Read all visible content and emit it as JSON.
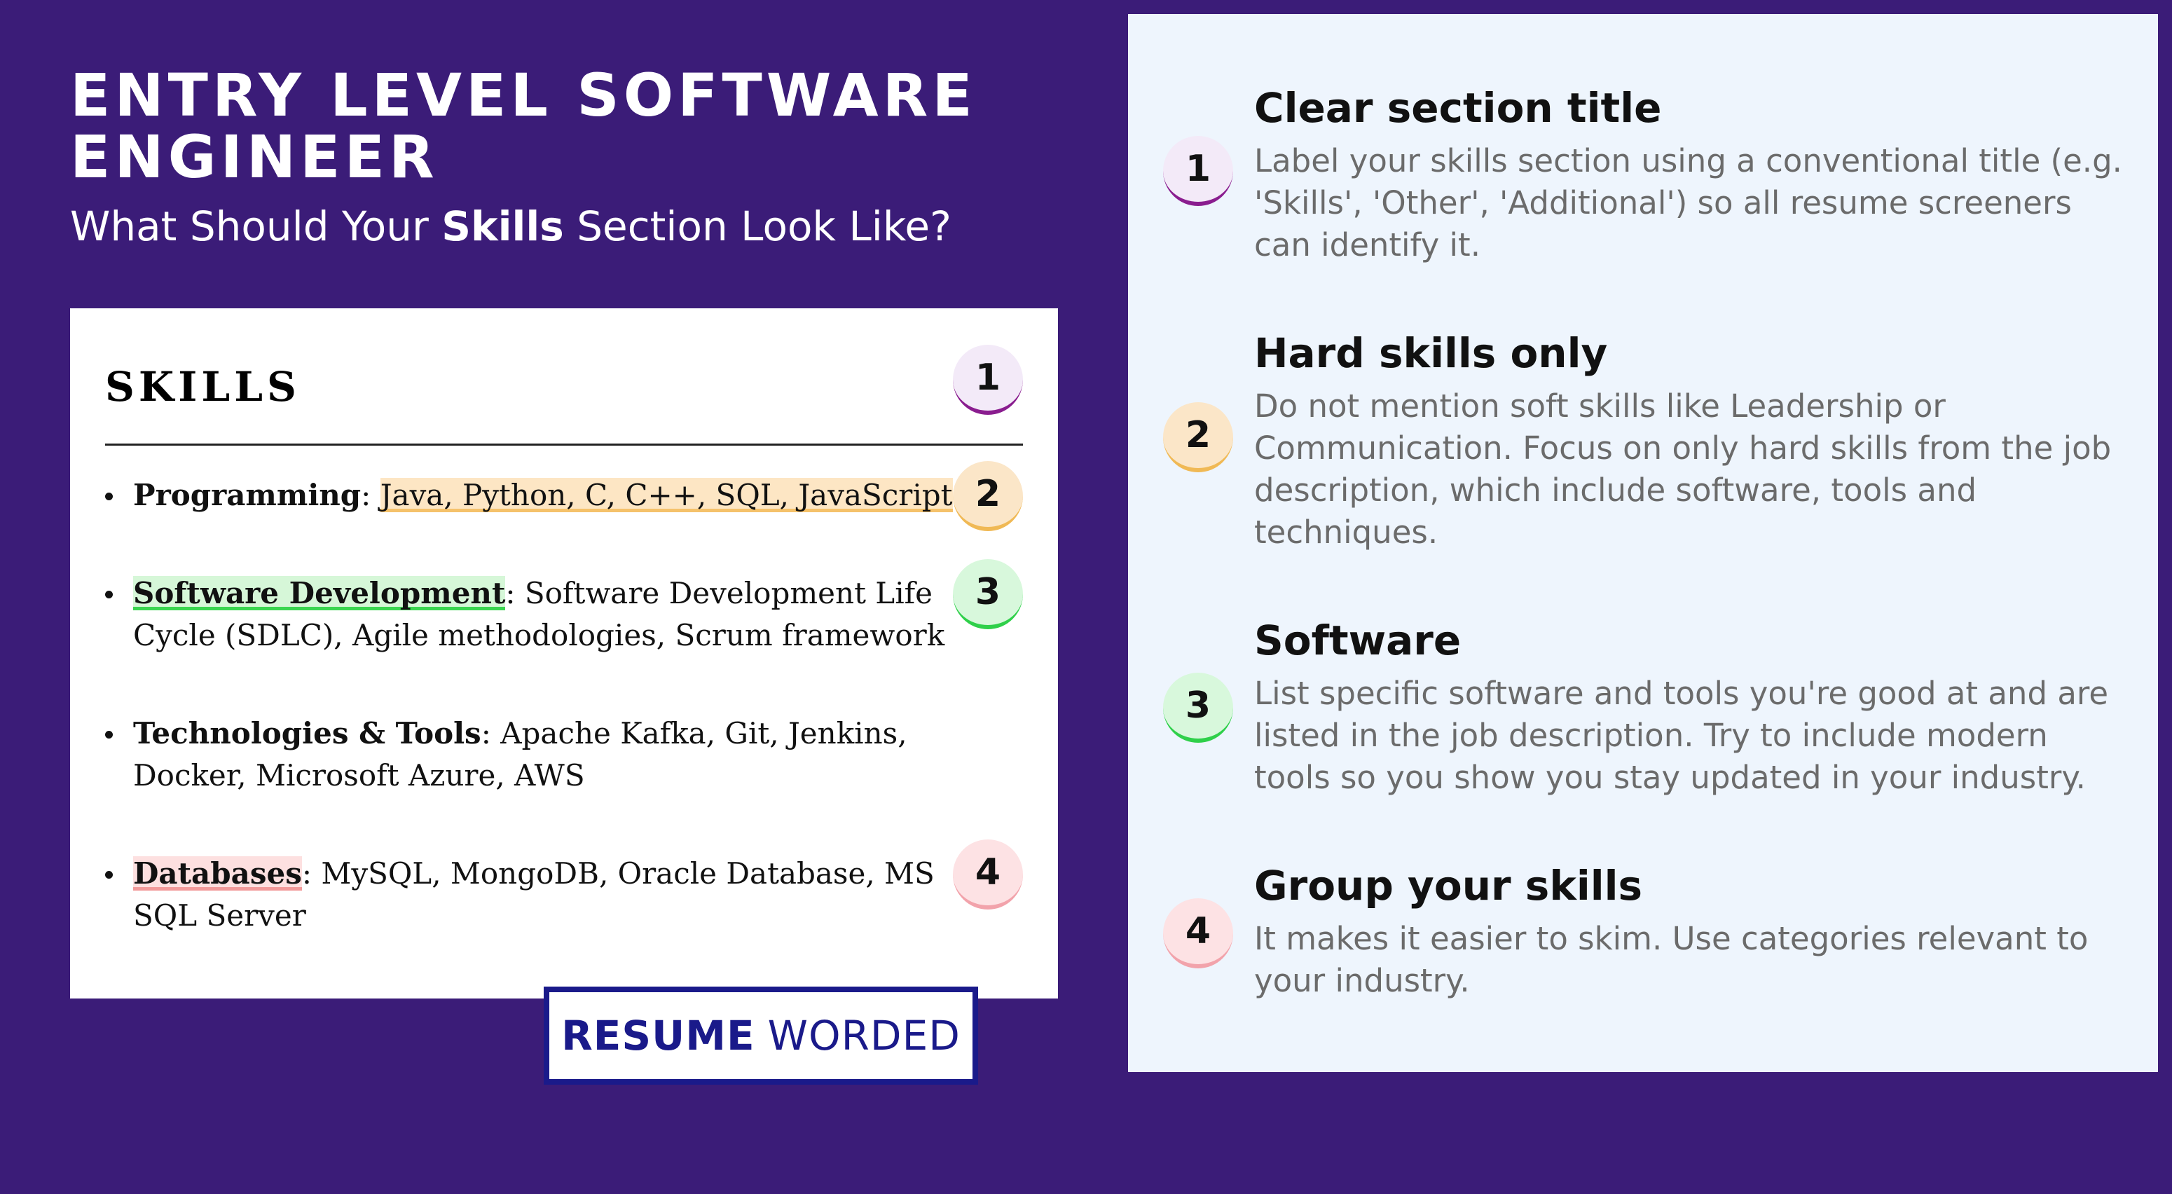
{
  "header": {
    "title": "ENTRY LEVEL SOFTWARE ENGINEER",
    "subtitle_before": "What Should Your ",
    "subtitle_bold": "Skills",
    "subtitle_after": " Section Look Like?"
  },
  "skills_card": {
    "heading": "SKILLS",
    "items": [
      {
        "label": "Programming",
        "sep": ": ",
        "text": "Java, Python, C, C++, SQL, JavaScript"
      },
      {
        "label": "Software Development",
        "sep": ": ",
        "text": "Software Development Life Cycle (SDLC), Agile methodologies, Scrum framework"
      },
      {
        "label": "Technologies & Tools",
        "sep": ": ",
        "text": "Apache Kafka, Git, Jenkins, Docker, Microsoft Azure, AWS"
      },
      {
        "label": "Databases",
        "sep": ": ",
        "text": "MySQL, MongoDB, Oracle Database, MS SQL Server"
      }
    ],
    "badges": [
      "1",
      "2",
      "3",
      "4"
    ]
  },
  "logo": {
    "bold": "RESUME",
    "light": "WORDED"
  },
  "tips": [
    {
      "number": "1",
      "title": "Clear section title",
      "desc": "Label your skills section using a conventional title (e.g. 'Skills', 'Other', 'Additional') so all resume screeners can identify it."
    },
    {
      "number": "2",
      "title": "Hard skills only",
      "desc": "Do not mention soft skills like Leadership or Communication. Focus on only hard skills from the job description, which include software, tools and techniques."
    },
    {
      "number": "3",
      "title": "Software",
      "desc": "List specific software and tools you're good at and are listed in the job description. Try to include modern tools so you show you stay updated in your industry."
    },
    {
      "number": "4",
      "title": "Group your skills",
      "desc": "It makes it easier to skim. Use categories relevant to your industry."
    }
  ],
  "colors": {
    "background": "#3b1c78",
    "panel": "#eef5fd",
    "brand": "#1a1a8a",
    "badge_purple": "#8a1d8f",
    "badge_orange": "#f0b955",
    "badge_green": "#2fd04a",
    "badge_pink": "#f2a3ab"
  }
}
